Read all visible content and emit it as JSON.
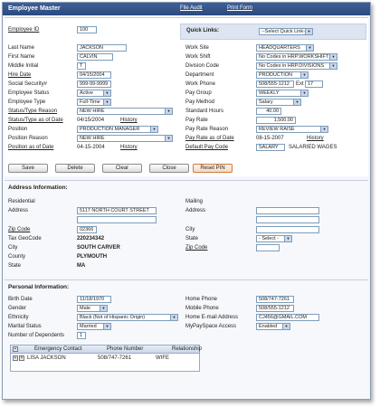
{
  "header": {
    "title": "Employee Master",
    "file_audit": "File Audit",
    "print_form": "Print Form"
  },
  "quick_links": {
    "label": "Quick Links:",
    "selected": "--Select Quick Link--"
  },
  "employee": {
    "id_label": "Employee ID",
    "id_value": "100",
    "last_name_label": "Last Name",
    "last_name": "JACKSON",
    "first_name_label": "First Name",
    "first_name": "CALVIN",
    "mi_label": "Middle Initial",
    "mi": "T",
    "hire_date_label": "Hire Date",
    "hire_date": "04/15/2004",
    "ssn_label": "Social Security#",
    "ssn": "999-99-9999",
    "status_label": "Employee Status",
    "status": "Active",
    "type_label": "Employee Type",
    "type": "Full-Time",
    "str_label": "Status/Type Reason",
    "str": "NEW HIRE",
    "st_asof_label": "Status/Type as of Date",
    "st_asof": "04/15/2004",
    "st_history": "History",
    "position_label": "Position",
    "position": "PRODUCTION MANAGER",
    "pos_reason_label": "Position Reason",
    "pos_reason": "NEW HIRE",
    "pos_asof_label": "Position as of Date",
    "pos_asof": "04-15-2004",
    "pos_history": "History"
  },
  "work": {
    "site_label": "Work Site",
    "site": "HEADQUARTERS",
    "shift_label": "Work Shift",
    "shift": "No Codes in HRP.WORKSHIFTS",
    "division_label": "Division Code",
    "division": "No Codes in HRP.DIVISIONS",
    "dept_label": "Department",
    "dept": "PRODUCTION",
    "phone_label": "Work Phone",
    "phone": "508/555-1212",
    "ext_label": "Ext",
    "ext": "17",
    "paygroup_label": "Pay Group",
    "paygroup": "WEEKLY",
    "paymethod_label": "Pay Method",
    "paymethod": "Salary",
    "hours_label": "Standard Hours",
    "hours": "40.00",
    "payrate_label": "Pay Rate",
    "payrate": "1,500.00",
    "rate_reason_label": "Pay Rate Reason",
    "rate_reason": "REVIEW RAISE",
    "rate_asof_label": "Pay Rate as of Date",
    "rate_asof": "08-15-2007",
    "rate_history": "History",
    "paycode_label": "Default Pay Code",
    "paycode": "SALARY",
    "paycode_desc": "SALARIED WAGES"
  },
  "buttons": {
    "save": "Save",
    "delete": "Delete",
    "clear": "Clear",
    "close": "Close",
    "reset_pin": "Reset PIN"
  },
  "address": {
    "section": "Address Information:",
    "res_label": "Residential",
    "addr_label": "Address",
    "addr1": "5117 NORTH COURT STREET",
    "addr2": "",
    "zip_label": "Zip Code",
    "zip": "02366",
    "geocode_label": "Tax GeoCode",
    "geocode": "220234342",
    "city_label": "City",
    "city": "SOUTH CARVER",
    "county_label": "County",
    "county": "PLYMOUTH",
    "state_label": "State",
    "state": "MA",
    "mail_label": "Mailing",
    "m_addr_label": "Address",
    "m_city_label": "City",
    "m_state_label": "State",
    "m_state": "- Select -",
    "m_zip_label": "Zip Code"
  },
  "personal": {
    "section": "Personal Information:",
    "birth_label": "Birth Date",
    "birth": "11/18/1970",
    "gender_label": "Gender",
    "gender": "Male",
    "ethnicity_label": "Ethnicity",
    "ethnicity": "Black (Not of Hispanic Origin)",
    "marital_label": "Marital Status",
    "marital": "Married",
    "dependents_label": "Number of Dependents",
    "dependents": "1",
    "home_phone_label": "Home Phone",
    "home_phone": "508/747-7261",
    "mobile_label": "Mobile Phone",
    "mobile": "508/555-1212",
    "email_label": "Home E-mail Address",
    "email": "CJ456@GMAIL.COM",
    "mypay_label": "MyPaySpace Access",
    "mypay": "Enabled"
  },
  "contacts": {
    "headers": [
      "Emergency Contact",
      "Phone Number",
      "Relationship"
    ],
    "rows": [
      {
        "name": "LISA JACKSON",
        "phone": "508/747-7261",
        "relationship": "WIFE"
      }
    ]
  }
}
